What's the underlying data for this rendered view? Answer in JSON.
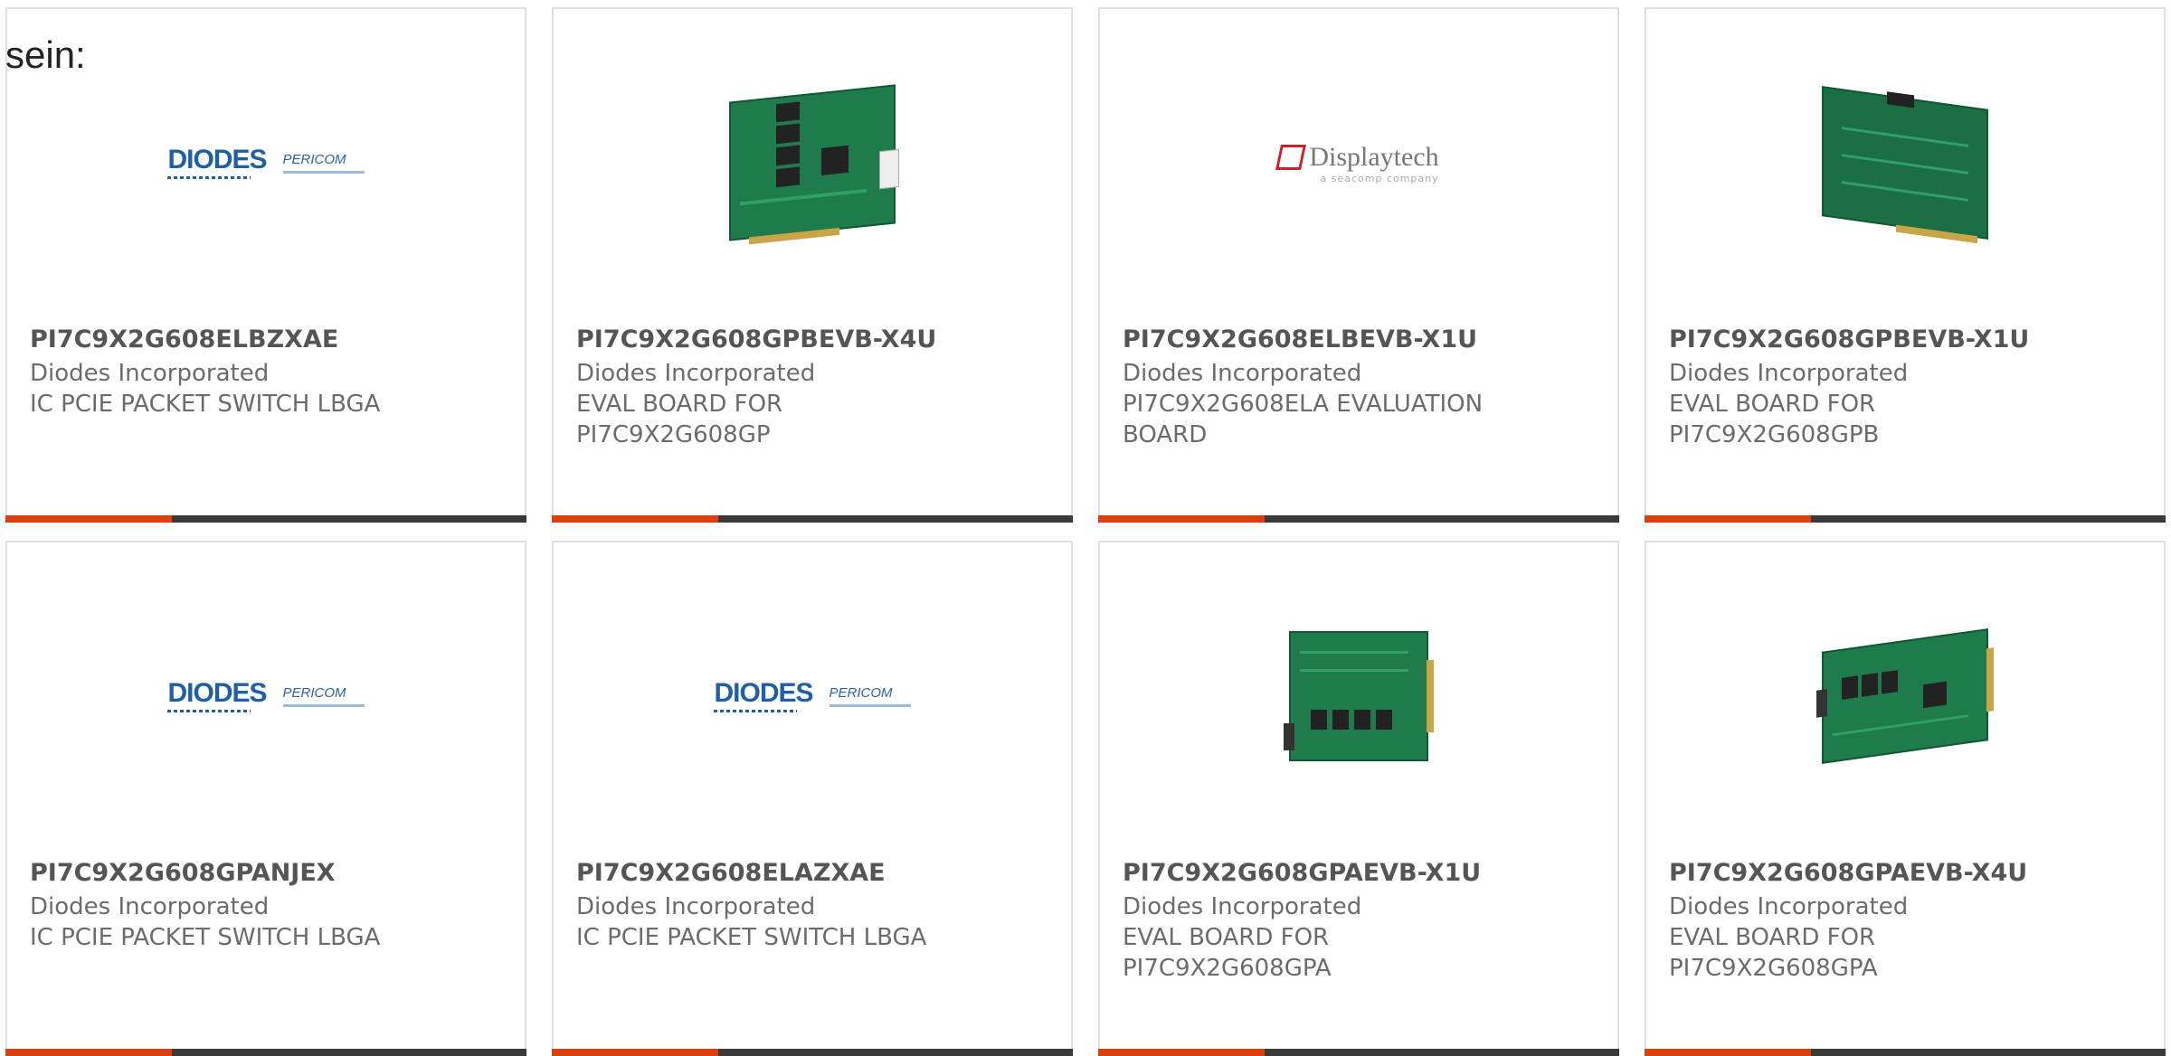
{
  "intro_text": "sein:",
  "cards": [
    {
      "part_no": "PI7C9X2G608ELBZXAE",
      "manufacturer": "Diodes Incorporated",
      "description": "IC PCIE PACKET SWITCH LBGA",
      "image": "diodes-pericom-logo"
    },
    {
      "part_no": "PI7C9X2G608GPBEVB-X4U",
      "manufacturer": "Diodes Incorporated",
      "description": "EVAL BOARD FOR\nPI7C9X2G608GP",
      "image": "pcb-board-photo"
    },
    {
      "part_no": "PI7C9X2G608ELBEVB-X1U",
      "manufacturer": "Diodes Incorporated",
      "description": "PI7C9X2G608ELA EVALUATION\nBOARD",
      "image": "displaytech-logo"
    },
    {
      "part_no": "PI7C9X2G608GPBEVB-X1U",
      "manufacturer": "Diodes Incorporated",
      "description": "EVAL BOARD FOR\nPI7C9X2G608GPB",
      "image": "pcb-board-photo"
    },
    {
      "part_no": "PI7C9X2G608GPANJEX",
      "manufacturer": "Diodes Incorporated",
      "description": "IC PCIE PACKET SWITCH LBGA",
      "image": "diodes-pericom-logo"
    },
    {
      "part_no": "PI7C9X2G608ELAZXAE",
      "manufacturer": "Diodes Incorporated",
      "description": "IC PCIE PACKET SWITCH LBGA",
      "image": "diodes-pericom-logo"
    },
    {
      "part_no": "PI7C9X2G608GPAEVB-X1U",
      "manufacturer": "Diodes Incorporated",
      "description": "EVAL BOARD FOR\nPI7C9X2G608GPA",
      "image": "pcb-board-photo"
    },
    {
      "part_no": "PI7C9X2G608GPAEVB-X4U",
      "manufacturer": "Diodes Incorporated",
      "description": "EVAL BOARD FOR\nPI7C9X2G608GPA",
      "image": "pcb-board-photo"
    }
  ],
  "logos": {
    "diodes": "DIODES",
    "pericom": "PERICOM",
    "displaytech": "Displaytech",
    "displaytech_sub": "a seacomp company"
  },
  "colors": {
    "accent": "#d9400e",
    "bar_dark": "#3a3a3a",
    "diodes_blue": "#1f5fa6",
    "displaytech_red": "#c8232c"
  }
}
